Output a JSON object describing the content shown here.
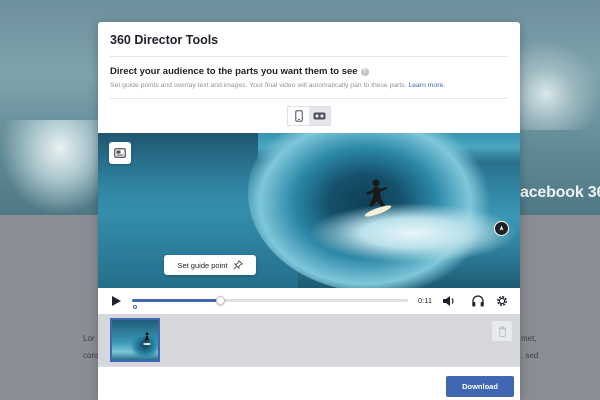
{
  "background": {
    "brand_text": "acebook 360",
    "para_left_lines": [
      "Lor",
      "cons"
    ],
    "para_right_lines": [
      "met,",
      ", sed"
    ]
  },
  "modal": {
    "title": "360 Director Tools",
    "section_heading": "Direct your audience to the parts you want them to see",
    "info_icon_glyph": "?",
    "subtitle": "Set guide points and overlay text and images. Your final video will automatically pan to these parts.",
    "learn_more": "Learn more.",
    "view_toggle": [
      {
        "icon": "phone-icon",
        "active": false
      },
      {
        "icon": "vr-headset-icon",
        "active": true
      }
    ]
  },
  "video": {
    "guide_button_label": "Set guide point",
    "controls": {
      "time": "0:11",
      "progress_fraction": 0.32
    }
  },
  "footer": {
    "download_label": "Download"
  },
  "colors": {
    "accent": "#4267b2",
    "text_primary": "#1d2129",
    "text_secondary": "#90949c"
  }
}
